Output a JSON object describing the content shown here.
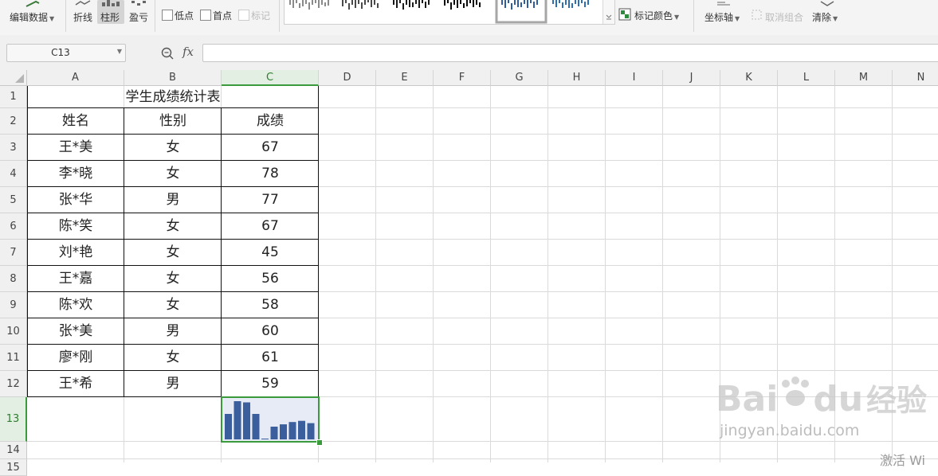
{
  "ribbon": {
    "edit_data": "编辑数据",
    "line": "折线",
    "column": "柱形",
    "winloss": "盈亏",
    "low_point": "低点",
    "first_point": "首点",
    "marker": "标记",
    "marker_color": "标记颜色",
    "axis": "坐标轴",
    "ungroup": "取消组合",
    "clear": "清除",
    "fx": "fx"
  },
  "namebox": {
    "value": "C13"
  },
  "formula_bar": {
    "value": ""
  },
  "columns": [
    "A",
    "B",
    "C",
    "D",
    "E",
    "F",
    "G",
    "H",
    "I",
    "J",
    "K",
    "L",
    "M",
    "N"
  ],
  "rows": [
    "1",
    "2",
    "3",
    "4",
    "5",
    "6",
    "7",
    "8",
    "9",
    "10",
    "11",
    "12",
    "13",
    "14",
    "15"
  ],
  "sheet": {
    "title": "学生成绩统计表",
    "headers": [
      "姓名",
      "性别",
      "成绩"
    ],
    "records": [
      [
        "王*美",
        "女",
        "67"
      ],
      [
        "李*晓",
        "女",
        "78"
      ],
      [
        "张*华",
        "男",
        "77"
      ],
      [
        "陈*笑",
        "女",
        "67"
      ],
      [
        "刘*艳",
        "女",
        "45"
      ],
      [
        "王*嘉",
        "女",
        "56"
      ],
      [
        "陈*欢",
        "女",
        "58"
      ],
      [
        "张*美",
        "男",
        "60"
      ],
      [
        "廖*刚",
        "女",
        "61"
      ],
      [
        "王*希",
        "男",
        "59"
      ]
    ]
  },
  "sparkline": {
    "cell": "C13",
    "type": "column",
    "values": [
      67,
      78,
      77,
      67,
      45,
      56,
      58,
      60,
      61,
      59
    ],
    "color": "#3a5f9c"
  },
  "colors": {
    "selection": "#3b9a3b",
    "sparkline_bg": "#e6ebf5"
  },
  "watermark": {
    "brand_a": "Bai",
    "brand_b": "du",
    "brand_cn": "经验",
    "url": "jingyan.baidu.com",
    "activate": "激活 Wi"
  }
}
